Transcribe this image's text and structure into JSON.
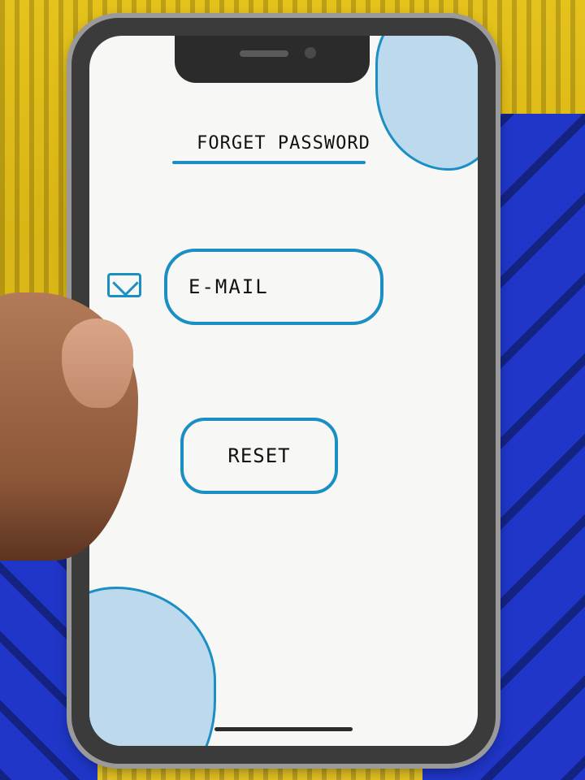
{
  "app": {
    "title": "FORGET PASSWORD"
  },
  "form": {
    "email_placeholder": "E-MAIL",
    "email_icon": "mail-icon",
    "reset_label": "RESET"
  },
  "colors": {
    "accent": "#1b8fc3",
    "blob_fill": "#bcd9ee",
    "screen_background": "#f7f7f5",
    "text": "#111111"
  }
}
